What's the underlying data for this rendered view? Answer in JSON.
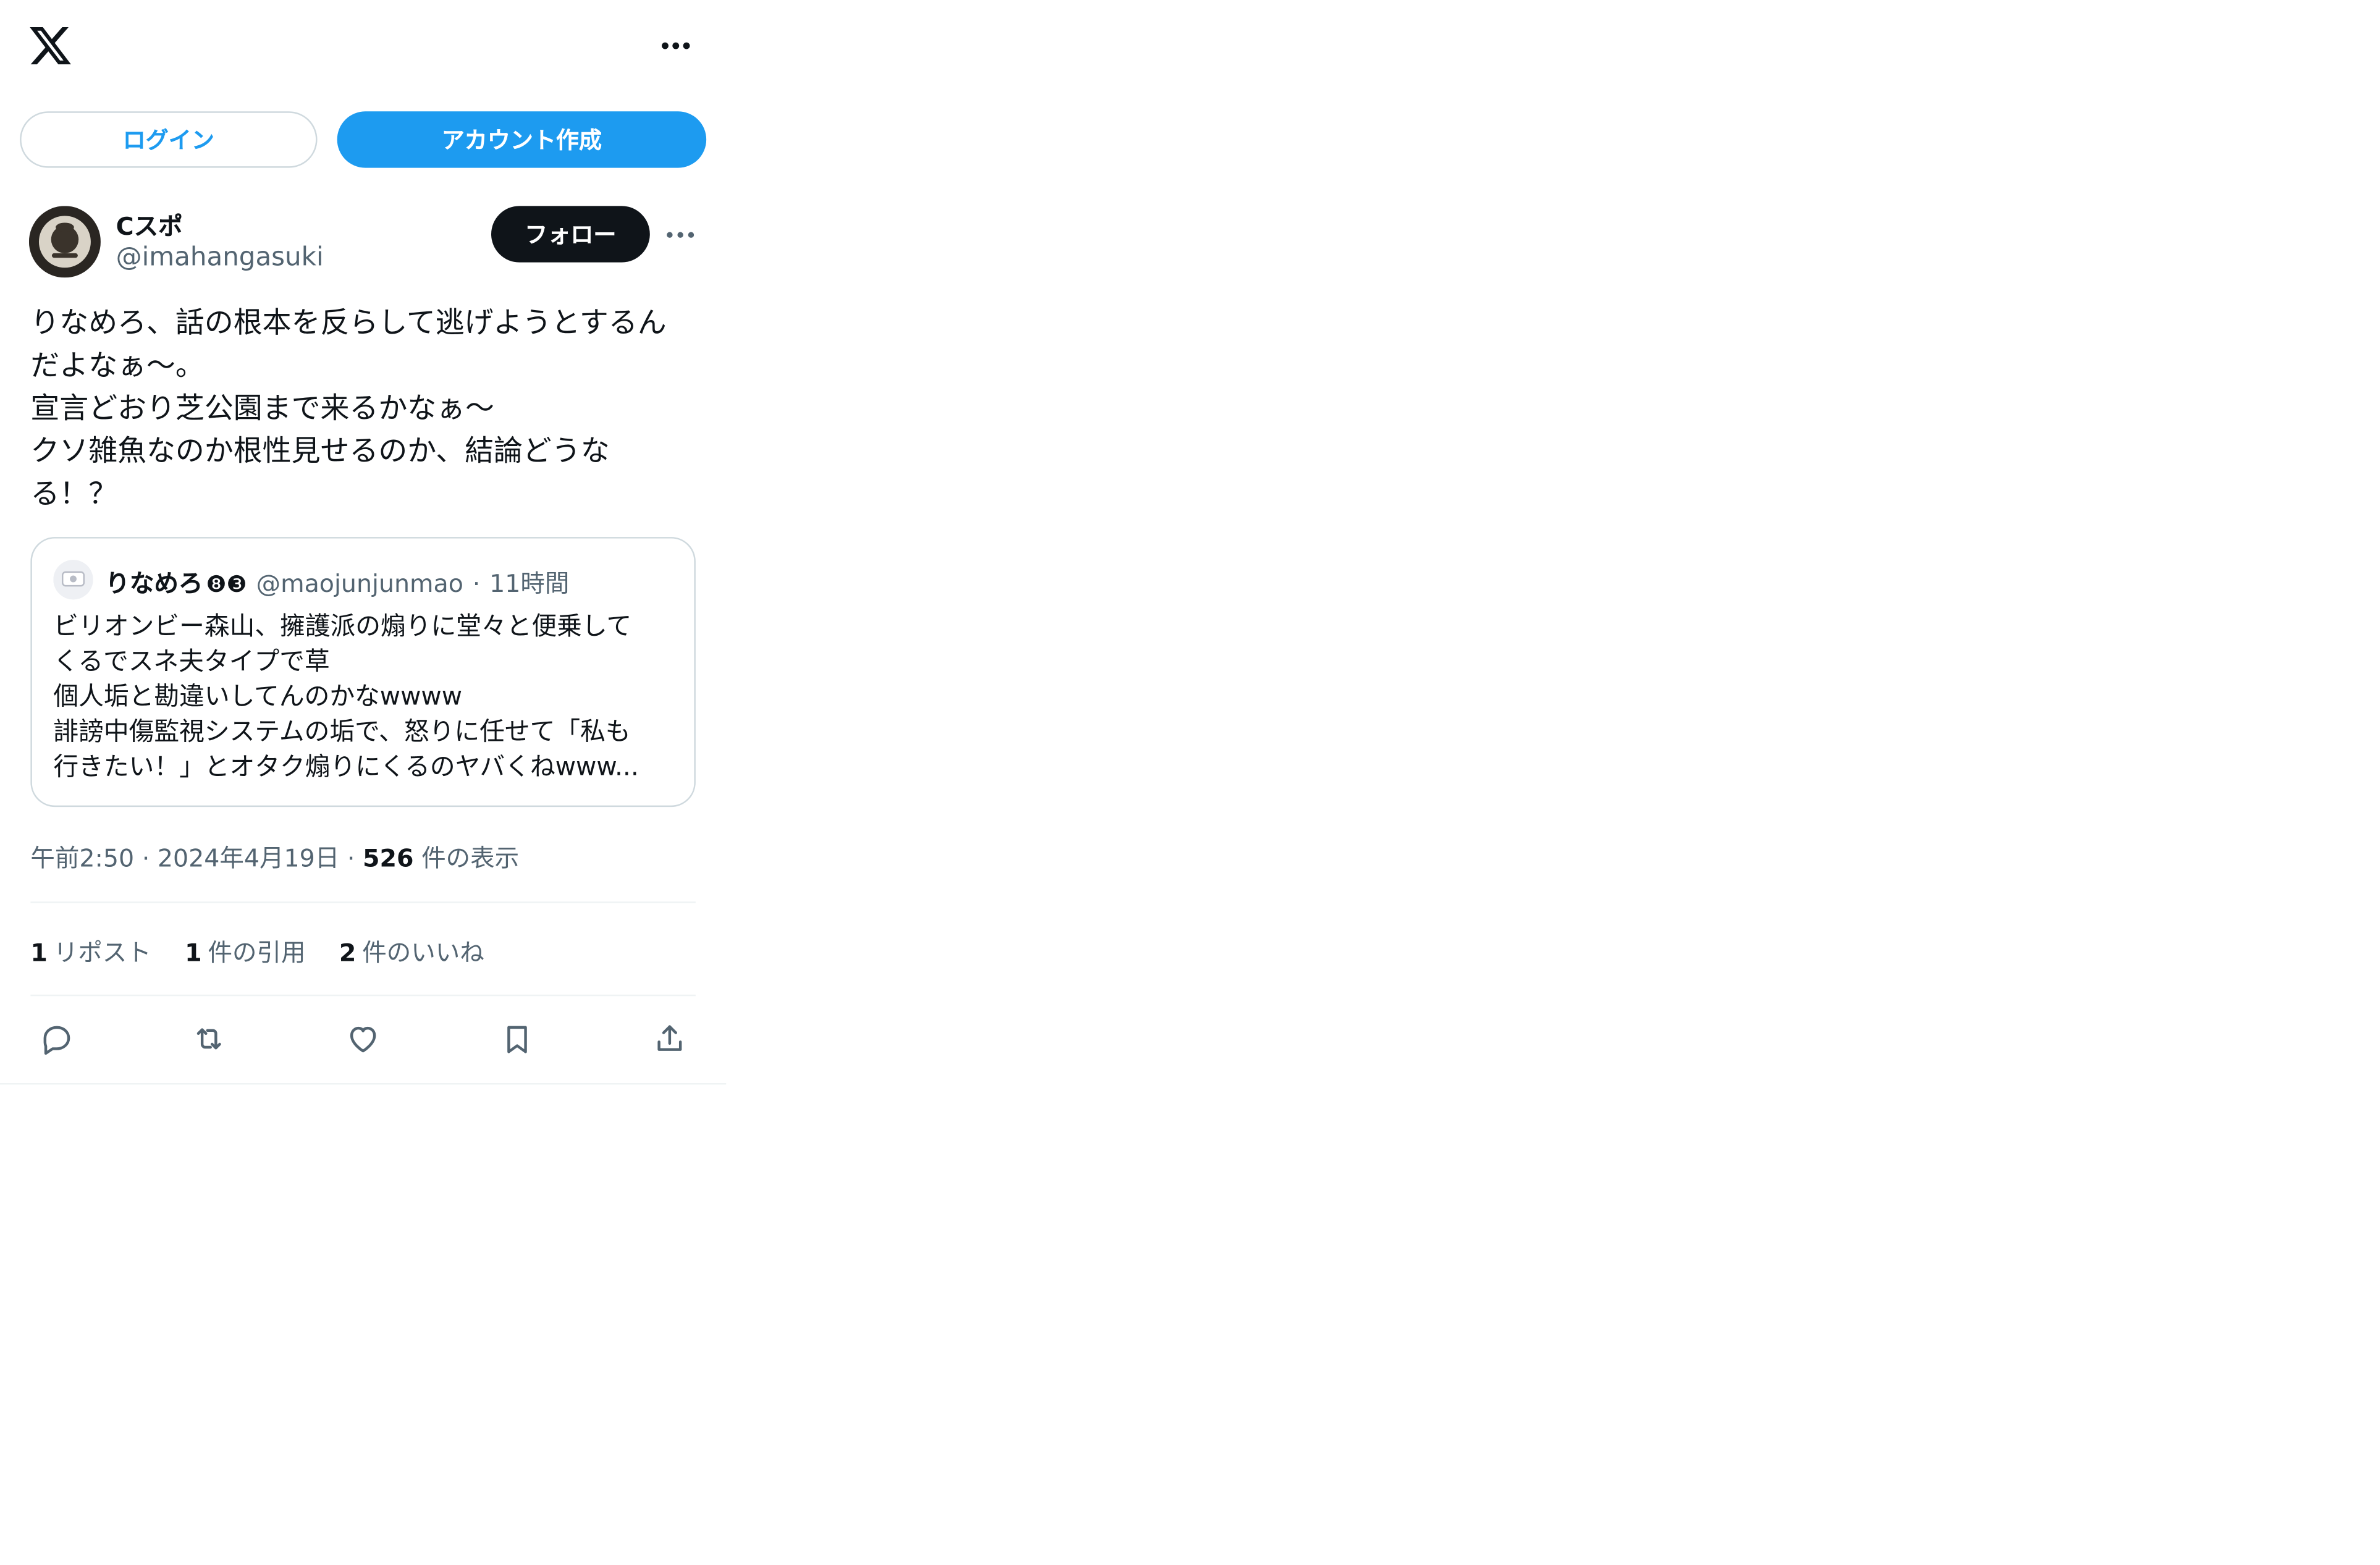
{
  "header": {
    "logo_icon": "x-logo-icon",
    "more_icon": "more-horizontal-icon"
  },
  "auth": {
    "login_label": "ログイン",
    "signup_label": "アカウント作成"
  },
  "post": {
    "author": {
      "display_name": "Cスポ",
      "handle": "@imahangasuki"
    },
    "follow_label": "フォロー",
    "text_lines": [
      "りなめろ、話の根本を反らして逃げようとするん",
      "だよなぁ〜。",
      "宣言どおり芝公園まで来るかなぁ〜",
      "クソ雑魚なのか根性見せるのか、結論どうな",
      "る！？"
    ],
    "quote": {
      "author_name": "りなめろ",
      "badges": "❽❸",
      "handle": "@maojunjunmao",
      "separator": "·",
      "time": "11時間",
      "text_lines": [
        "ビリオンビー森山、擁護派の煽りに堂々と便乗して",
        "くるでスネ夫タイプで草",
        "個人垢と勘違いしてんのかなwwww",
        "誹謗中傷監視システムの垢で、怒りに任せて「私も",
        "行きたい！」とオタク煽りにくるのヤバくねwww..."
      ]
    },
    "time": "午前2:50",
    "date": "2024年4月19日",
    "separator": "·",
    "views_count": "526",
    "views_label": "件の表示",
    "stats": {
      "reposts_count": "1",
      "reposts_label": "リポスト",
      "quotes_count": "1",
      "quotes_label": "件の引用",
      "likes_count": "2",
      "likes_label": "件のいいね"
    },
    "actions": [
      "reply-icon",
      "repost-icon",
      "like-icon",
      "bookmark-icon",
      "share-icon"
    ]
  },
  "colors": {
    "accent": "#1d9bf0",
    "text": "#0f1419",
    "secondary": "#536471",
    "border": "#cfd9de"
  }
}
